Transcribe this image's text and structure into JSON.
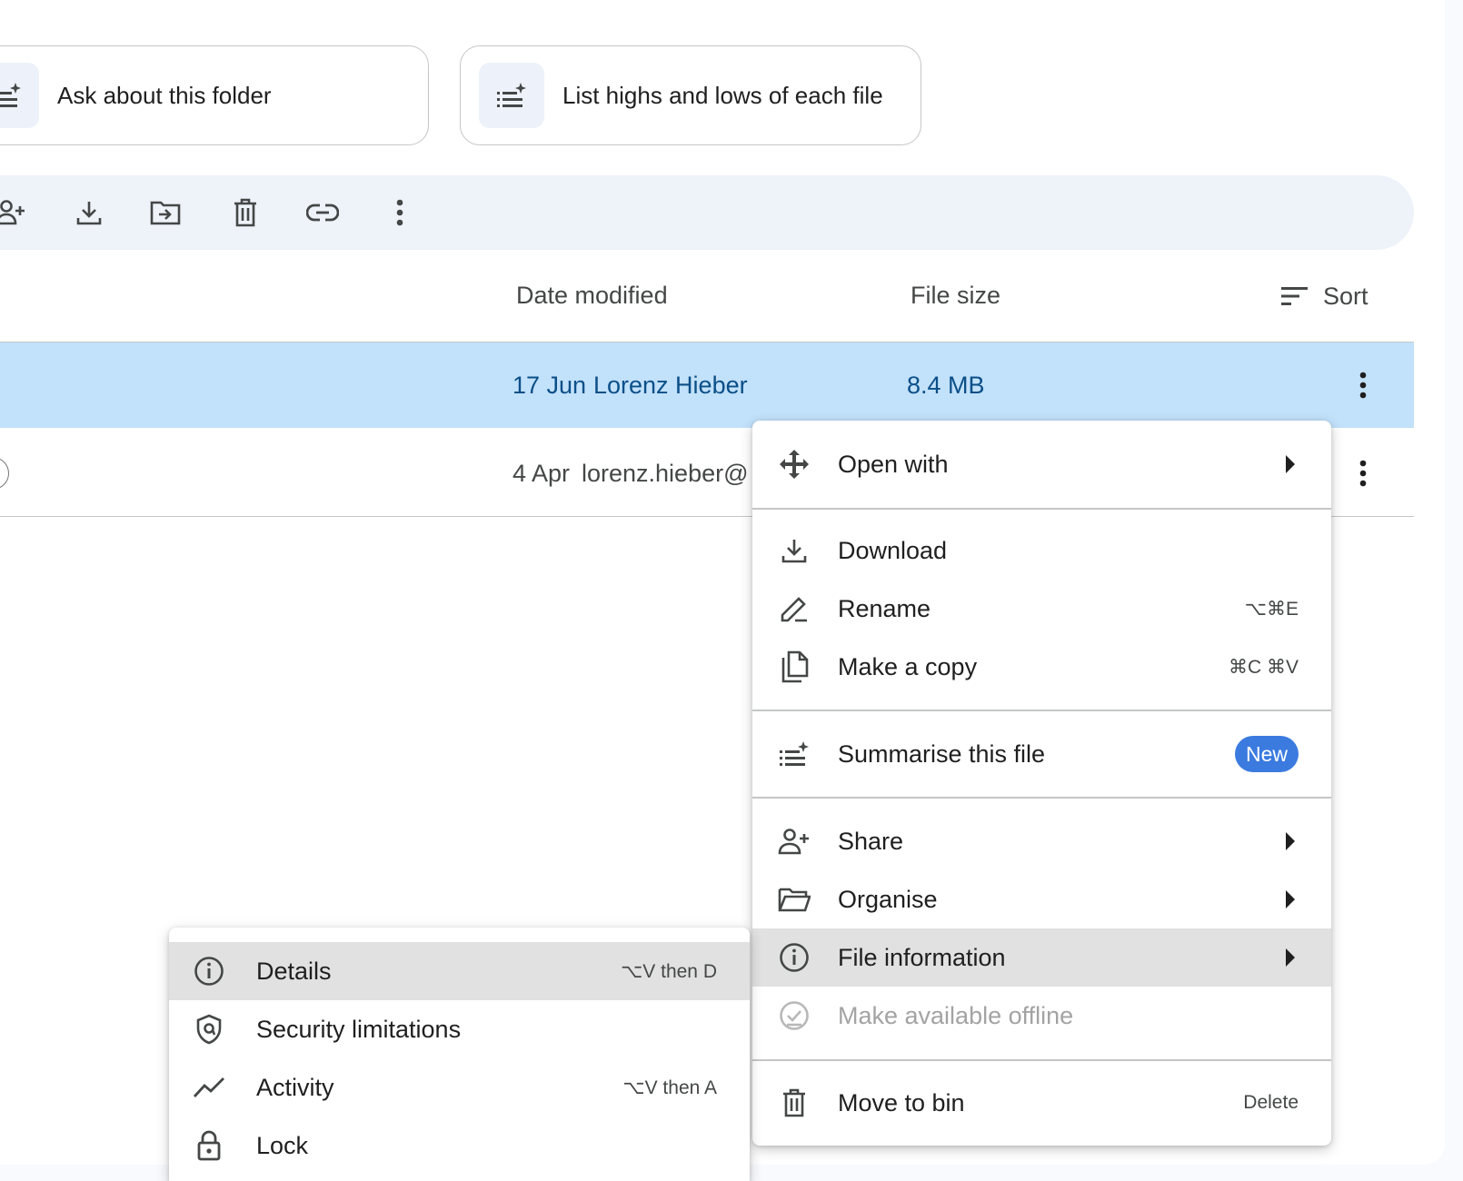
{
  "suggestion_chips": [
    {
      "label": "Ask about this folder",
      "icon": "sparkle-list-icon"
    },
    {
      "label": "List highs and lows of each file",
      "icon": "sparkle-list-icon"
    }
  ],
  "toolbar": {
    "actions": [
      "share-icon",
      "download-icon",
      "move-icon",
      "trash-icon",
      "link-icon",
      "more-icon"
    ]
  },
  "columns": {
    "date_modified": "Date modified",
    "file_size": "File size",
    "sort": "Sort"
  },
  "rows": [
    {
      "date": "17 Jun",
      "modified_by": "Lorenz Hieber",
      "size": "8.4 MB",
      "selected": true
    },
    {
      "date": "4 Apr",
      "modified_by": "lorenz.hieber@",
      "size": "",
      "selected": false
    }
  ],
  "context_menu": {
    "open_with": "Open with",
    "download": "Download",
    "rename": "Rename",
    "rename_shortcut": "⌥⌘E",
    "make_copy": "Make a copy",
    "make_copy_shortcut": "⌘C ⌘V",
    "summarise": "Summarise this file",
    "summarise_badge": "New",
    "share": "Share",
    "organise": "Organise",
    "file_information": "File information",
    "make_offline": "Make available offline",
    "move_to_bin": "Move to bin",
    "move_to_bin_shortcut": "Delete"
  },
  "submenu": {
    "details": "Details",
    "details_shortcut": "⌥V then D",
    "security": "Security limitations",
    "activity": "Activity",
    "activity_shortcut": "⌥V then A",
    "lock": "Lock"
  },
  "colors": {
    "selected_row": "#c2e1fa",
    "accent_badge": "#3b7be0",
    "toolbar_bg": "#eef2f9"
  }
}
